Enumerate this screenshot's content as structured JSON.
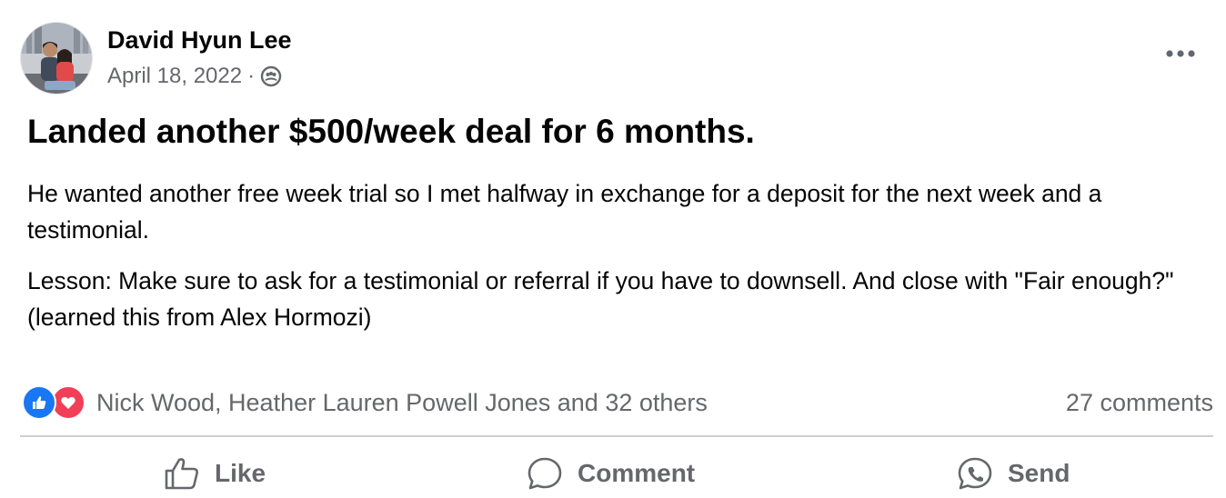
{
  "post": {
    "author": "David Hyun Lee",
    "date": "April 18, 2022",
    "separator": "·",
    "audience_icon": "group-icon",
    "headline": "Landed another $500/week deal for 6 months.",
    "paragraphs": [
      "He wanted another free week trial so I met halfway in exchange for a deposit for the next week and a testimonial.",
      "Lesson: Make sure to ask for a testimonial or referral if you have to downsell. And close with \"Fair enough?\" (learned this from Alex Hormozi)"
    ]
  },
  "reactions": {
    "types": [
      "like",
      "love"
    ],
    "summary": "Nick Wood, Heather Lauren Powell Jones and 32 others",
    "comments": "27 comments"
  },
  "actions": {
    "like": "Like",
    "comment": "Comment",
    "send": "Send"
  },
  "colors": {
    "like_blue": "#1877f2",
    "love_red": "#f33e58",
    "secondary_text": "#65676b"
  }
}
